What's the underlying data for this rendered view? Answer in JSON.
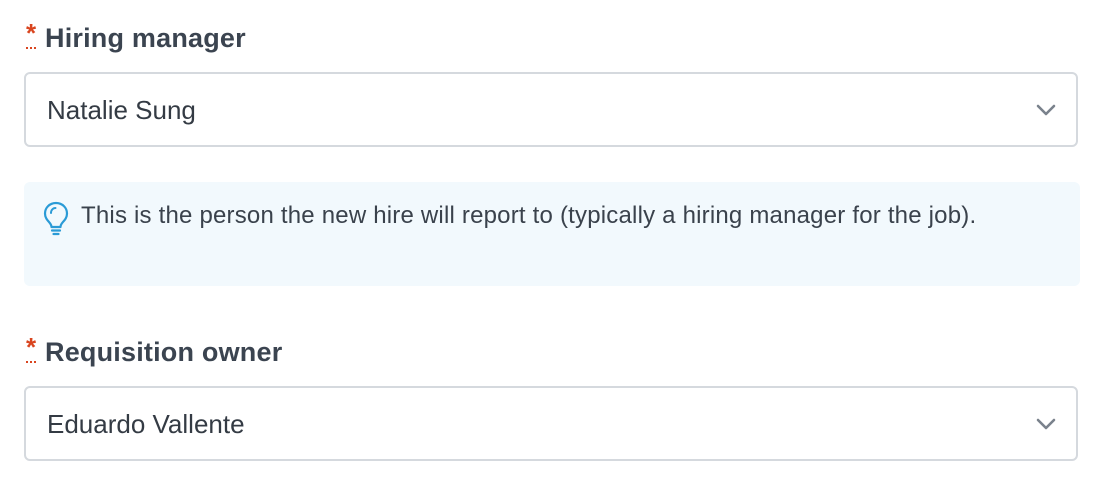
{
  "fields": {
    "hiring_manager": {
      "label": "Hiring manager",
      "required_mark": "*",
      "value": "Natalie Sung"
    },
    "requisition_owner": {
      "label": "Requisition owner",
      "required_mark": "*",
      "value": "Eduardo Vallente"
    }
  },
  "hint": {
    "icon": "lightbulb-icon",
    "text": "This is the person the new hire will report to (typically a hiring manager for the job)."
  },
  "colors": {
    "required": "#d9451f",
    "hint_background": "#f2f9fd",
    "hint_icon": "#2b9bd6",
    "border": "#d5d9de",
    "label_text": "#3b4450"
  }
}
